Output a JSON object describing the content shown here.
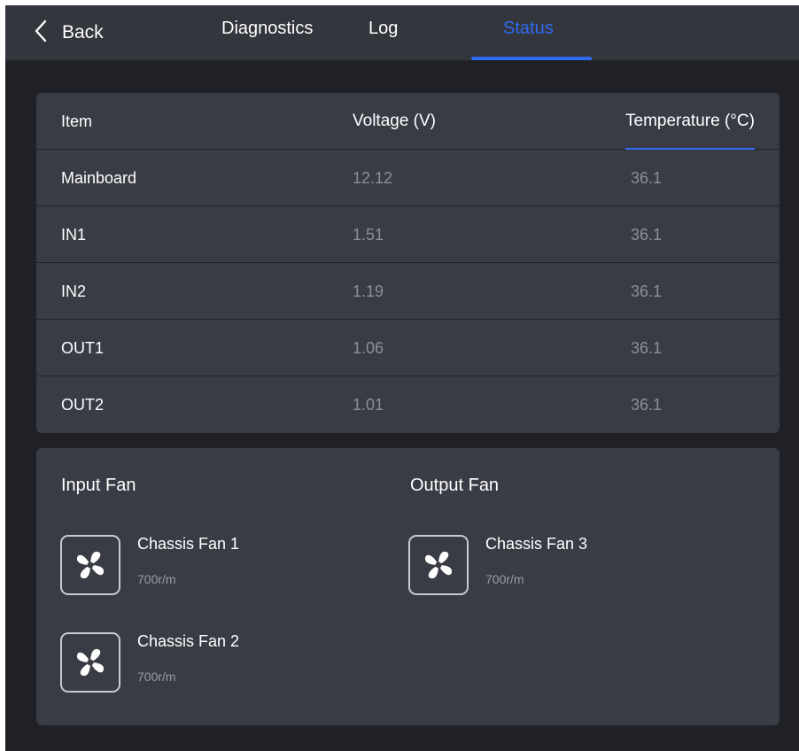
{
  "header": {
    "back_label": "Back",
    "tabs": [
      {
        "label": "Diagnostics",
        "active": false
      },
      {
        "label": "Log",
        "active": false
      },
      {
        "label": "Status",
        "active": true
      }
    ]
  },
  "table": {
    "columns": [
      "Item",
      "Voltage (V)",
      "Temperature (°C)"
    ],
    "rows": [
      {
        "item": "Mainboard",
        "voltage": "12.12",
        "temperature": "36.1"
      },
      {
        "item": "IN1",
        "voltage": "1.51",
        "temperature": "36.1"
      },
      {
        "item": "IN2",
        "voltage": "1.19",
        "temperature": "36.1"
      },
      {
        "item": "OUT1",
        "voltage": "1.06",
        "temperature": "36.1"
      },
      {
        "item": "OUT2",
        "voltage": "1.01",
        "temperature": "36.1"
      }
    ]
  },
  "fans": {
    "input_title": "Input Fan",
    "output_title": "Output Fan",
    "input": [
      {
        "name": "Chassis Fan 1",
        "speed": "700r/m",
        "icon": "fan-icon"
      },
      {
        "name": "Chassis Fan 2",
        "speed": "700r/m",
        "icon": "fan-icon"
      }
    ],
    "output": [
      {
        "name": "Chassis Fan 3",
        "speed": "700r/m",
        "icon": "fan-icon"
      }
    ]
  },
  "colors": {
    "accent": "#2f6bf0",
    "background": "#202127",
    "card": "#3a3c45",
    "topbar": "#34363e"
  }
}
